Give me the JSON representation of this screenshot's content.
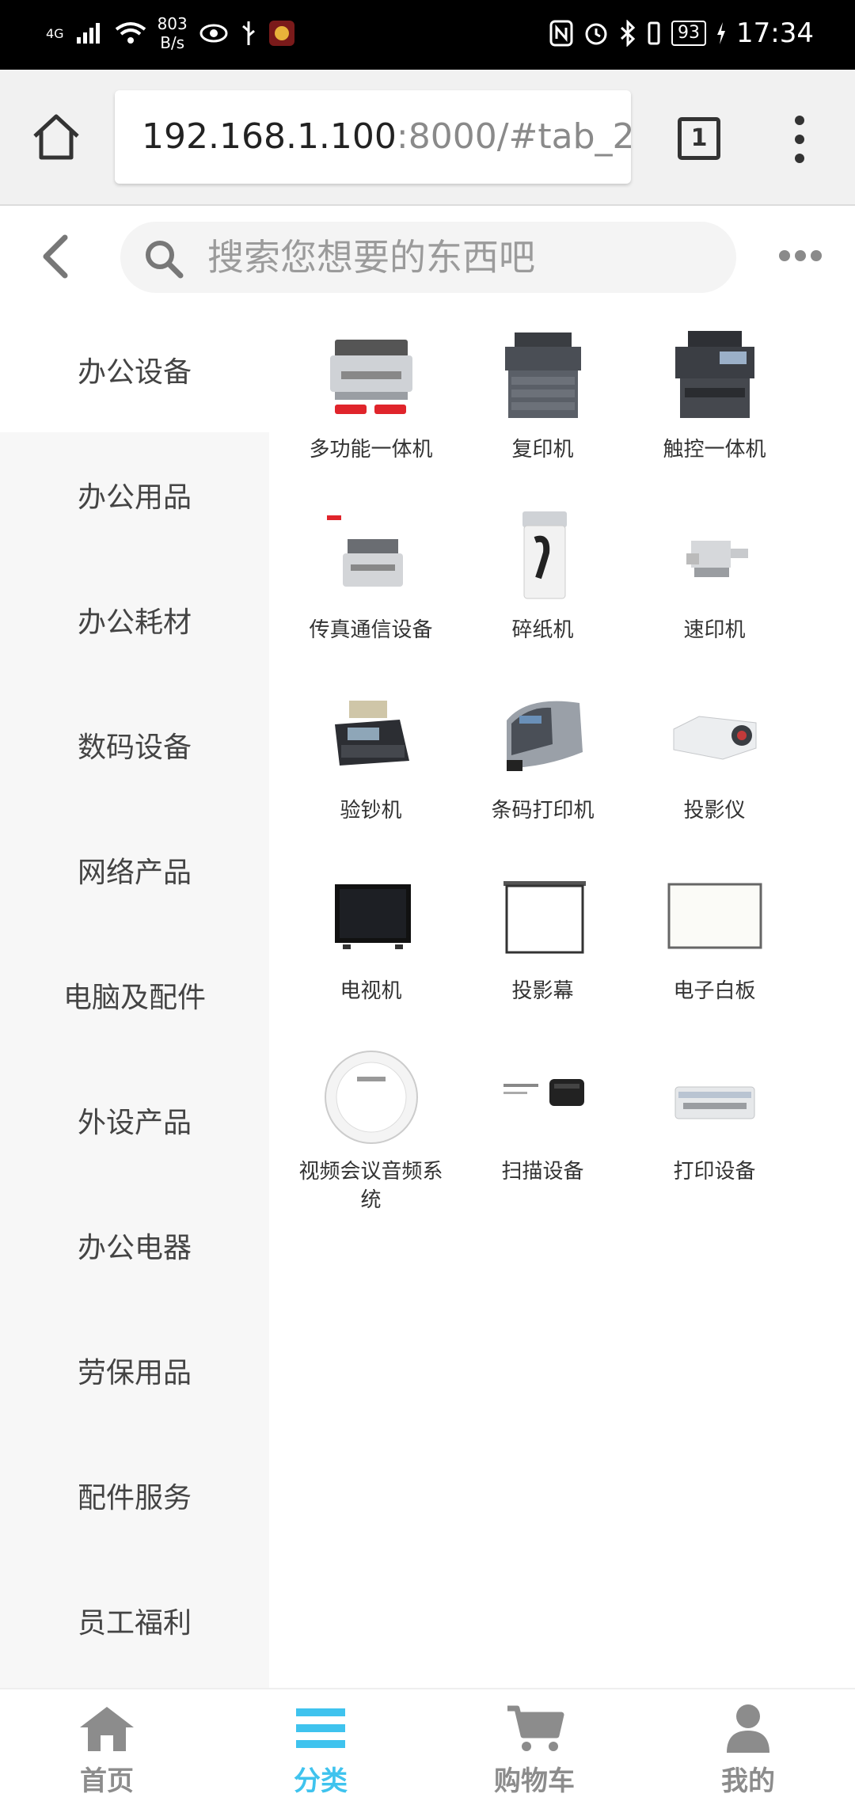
{
  "status_bar": {
    "network": "4G",
    "speed_value": "803",
    "speed_unit": "B/s",
    "battery": "93",
    "time": "17:34"
  },
  "browser": {
    "url_host": "192.168.1.100",
    "url_rest": ":8000/#tab_2",
    "tab_count": "1"
  },
  "search": {
    "placeholder": "搜索您想要的东西吧"
  },
  "categories": [
    {
      "label": "办公设备"
    },
    {
      "label": "办公用品"
    },
    {
      "label": "办公耗材"
    },
    {
      "label": "数码设备"
    },
    {
      "label": "网络产品"
    },
    {
      "label": "电脑及配件"
    },
    {
      "label": "外设产品"
    },
    {
      "label": "办公电器"
    },
    {
      "label": "劳保用品"
    },
    {
      "label": "配件服务"
    },
    {
      "label": "员工福利"
    }
  ],
  "products": [
    {
      "label": "多功能一体机",
      "icon": "mfp-printer-icon"
    },
    {
      "label": "复印机",
      "icon": "copier-icon"
    },
    {
      "label": "触控一体机",
      "icon": "touch-mfp-icon"
    },
    {
      "label": "传真通信设备",
      "icon": "fax-icon"
    },
    {
      "label": "碎纸机",
      "icon": "shredder-icon"
    },
    {
      "label": "速印机",
      "icon": "duplicator-icon"
    },
    {
      "label": "验钞机",
      "icon": "money-counter-icon"
    },
    {
      "label": "条码打印机",
      "icon": "barcode-printer-icon"
    },
    {
      "label": "投影仪",
      "icon": "projector-icon"
    },
    {
      "label": "电视机",
      "icon": "tv-icon"
    },
    {
      "label": "投影幕",
      "icon": "projection-screen-icon"
    },
    {
      "label": "电子白板",
      "icon": "whiteboard-icon"
    },
    {
      "label": "视频会议音频系统",
      "icon": "conference-speaker-icon"
    },
    {
      "label": "扫描设备",
      "icon": "scanner-icon"
    },
    {
      "label": "打印设备",
      "icon": "dot-matrix-printer-icon"
    }
  ],
  "tabs": [
    {
      "label": "首页",
      "icon": "home-icon"
    },
    {
      "label": "分类",
      "icon": "category-icon"
    },
    {
      "label": "购物车",
      "icon": "cart-icon"
    },
    {
      "label": "我的",
      "icon": "user-icon"
    }
  ],
  "colors": {
    "accent": "#3fc3ee",
    "inactive": "#8c8c8c",
    "sidebar_bg": "#f7f7f7"
  }
}
